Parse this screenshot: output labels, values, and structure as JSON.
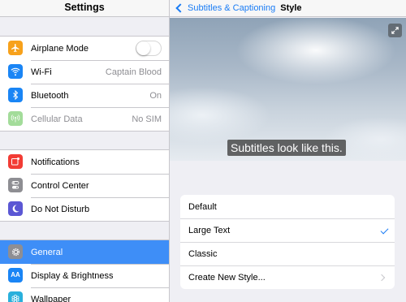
{
  "left_pane": {
    "title": "Settings",
    "groups": [
      {
        "items": [
          {
            "label": "Airplane Mode",
            "icon": "airplane-icon",
            "icon_color": "#f7a11b",
            "toggle": false
          },
          {
            "label": "Wi-Fi",
            "icon": "wifi-icon",
            "icon_color": "#1a85f5",
            "value": "Captain Blood"
          },
          {
            "label": "Bluetooth",
            "icon": "bluetooth-icon",
            "icon_color": "#1a85f5",
            "value": "On"
          },
          {
            "label": "Cellular Data",
            "icon": "cellular-icon",
            "icon_color": "#a3dc9a",
            "value": "No SIM",
            "disabled": true
          }
        ]
      },
      {
        "items": [
          {
            "label": "Notifications",
            "icon": "notifications-icon",
            "icon_color": "#f23c35"
          },
          {
            "label": "Control Center",
            "icon": "control-center-icon",
            "icon_color": "#8e8e93"
          },
          {
            "label": "Do Not Disturb",
            "icon": "moon-icon",
            "icon_color": "#5b57d4"
          }
        ]
      },
      {
        "items": [
          {
            "label": "General",
            "icon": "gear-icon",
            "icon_color": "#8e8e93",
            "selected": true
          },
          {
            "label": "Display & Brightness",
            "icon": "display-icon",
            "icon_color": "#1a85f5",
            "icon_text": "AA"
          },
          {
            "label": "Wallpaper",
            "icon": "wallpaper-icon",
            "icon_color": "#29b0dc"
          }
        ]
      }
    ]
  },
  "right_pane": {
    "back_label": "Subtitles & Captioning",
    "title": "Style",
    "preview_caption": "Subtitles look like this.",
    "options": [
      {
        "label": "Default"
      },
      {
        "label": "Large Text",
        "checked": true
      },
      {
        "label": "Classic"
      },
      {
        "label": "Create New Style...",
        "disclosure": true
      }
    ]
  },
  "colors": {
    "accent": "#1a7cf5",
    "selection": "#3e8ef7"
  }
}
